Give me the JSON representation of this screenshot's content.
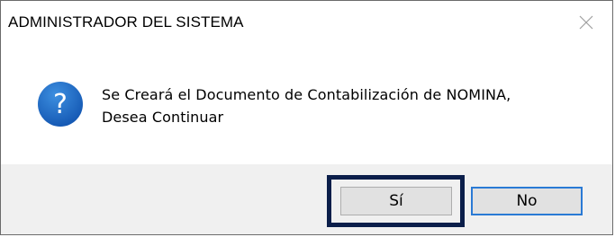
{
  "dialog": {
    "title": "ADMINISTRADOR DEL SISTEMA",
    "close_icon": "close-icon",
    "icon": "question-icon",
    "message_line1": "Se Creará el Documento de Contabilización de NOMINA,",
    "message_line2": "Desea Continuar",
    "buttons": {
      "yes_label": "Sí",
      "no_label": "No"
    }
  },
  "colors": {
    "icon_blue": "#1f6fc5",
    "highlight": "#0b1e4a",
    "default_button_border": "#2a7ad5",
    "footer_bg": "#f0f0f0"
  }
}
